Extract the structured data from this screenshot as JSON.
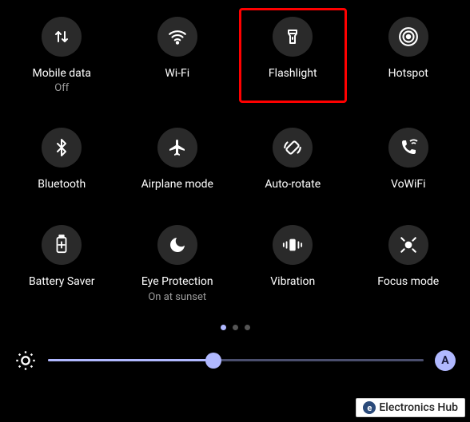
{
  "tiles": [
    {
      "id": "mobile-data",
      "label": "Mobile data",
      "sublabel": "Off",
      "icon": "mobile-data-icon",
      "highlighted": false
    },
    {
      "id": "wifi",
      "label": "Wi-Fi",
      "sublabel": "",
      "icon": "wifi-icon",
      "highlighted": false
    },
    {
      "id": "flashlight",
      "label": "Flashlight",
      "sublabel": "",
      "icon": "flashlight-icon",
      "highlighted": true
    },
    {
      "id": "hotspot",
      "label": "Hotspot",
      "sublabel": "",
      "icon": "hotspot-icon",
      "highlighted": false
    },
    {
      "id": "bluetooth",
      "label": "Bluetooth",
      "sublabel": "",
      "icon": "bluetooth-icon",
      "highlighted": false
    },
    {
      "id": "airplane",
      "label": "Airplane mode",
      "sublabel": "",
      "icon": "airplane-icon",
      "highlighted": false
    },
    {
      "id": "auto-rotate",
      "label": "Auto-rotate",
      "sublabel": "",
      "icon": "auto-rotate-icon",
      "highlighted": false
    },
    {
      "id": "vowifi",
      "label": "VoWiFi",
      "sublabel": "",
      "icon": "vowifi-icon",
      "highlighted": false
    },
    {
      "id": "battery-saver",
      "label": "Battery Saver",
      "sublabel": "",
      "icon": "battery-saver-icon",
      "highlighted": false
    },
    {
      "id": "eye-protection",
      "label": "Eye Protection",
      "sublabel": "On at sunset",
      "icon": "eye-protection-icon",
      "highlighted": false
    },
    {
      "id": "vibration",
      "label": "Vibration",
      "sublabel": "",
      "icon": "vibration-icon",
      "highlighted": false
    },
    {
      "id": "focus-mode",
      "label": "Focus mode",
      "sublabel": "",
      "icon": "focus-mode-icon",
      "highlighted": false
    }
  ],
  "pages": {
    "count": 3,
    "active": 0
  },
  "brightness": {
    "percent": 44,
    "auto_label": "A"
  },
  "watermark": {
    "text": "Electronics Hub",
    "logo_letter": "e"
  }
}
